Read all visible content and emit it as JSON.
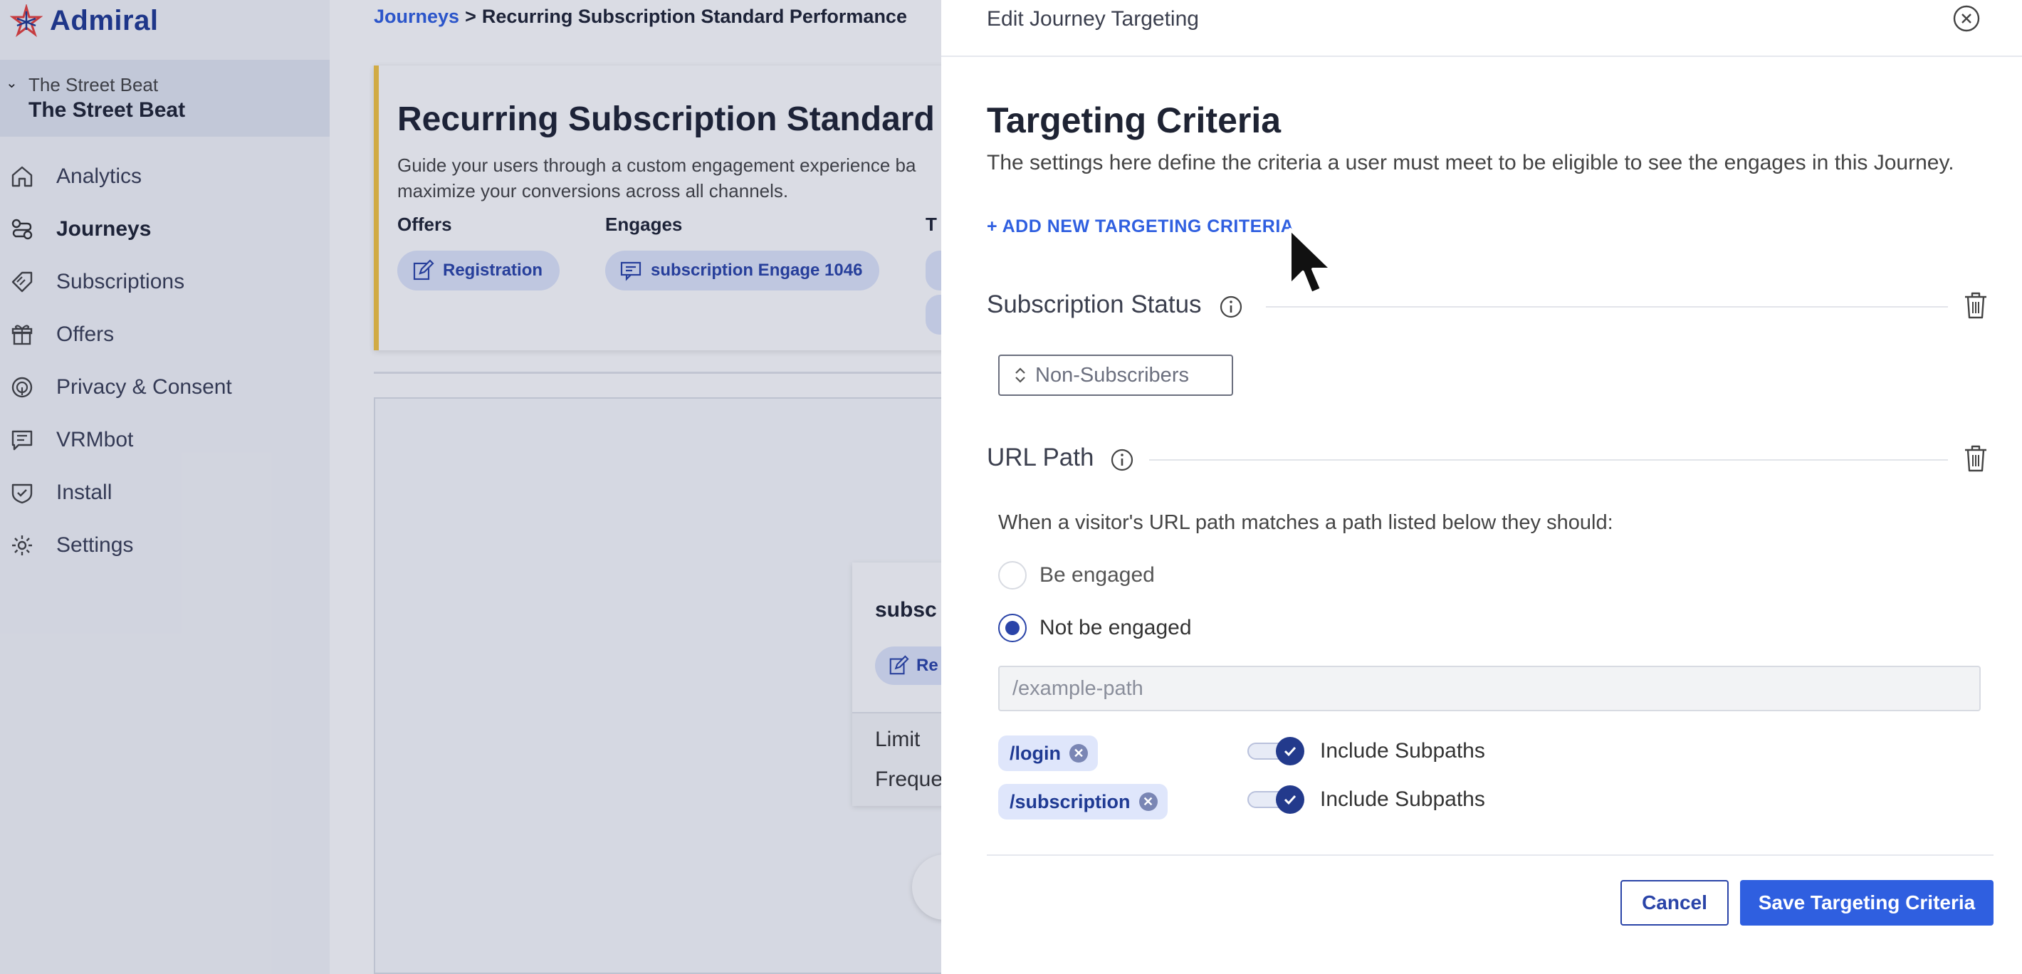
{
  "app": {
    "logo_text": "Admiral",
    "logo_icon": "admiral-star-icon"
  },
  "sidebar": {
    "site_sub": "The Street Beat",
    "site_main": "The Street Beat",
    "items": [
      {
        "label": "Analytics",
        "icon": "home-icon"
      },
      {
        "label": "Journeys",
        "icon": "journeys-icon",
        "active": true
      },
      {
        "label": "Subscriptions",
        "icon": "tag-icon"
      },
      {
        "label": "Offers",
        "icon": "gift-icon"
      },
      {
        "label": "Privacy & Consent",
        "icon": "privacy-icon"
      },
      {
        "label": "VRMbot",
        "icon": "chat-icon"
      },
      {
        "label": "Install",
        "icon": "shield-icon"
      },
      {
        "label": "Settings",
        "icon": "gear-icon"
      }
    ]
  },
  "main": {
    "breadcrumb": {
      "link": "Journeys",
      "separator": ">",
      "current": "Recurring Subscription Standard Performance"
    },
    "card": {
      "title": "Recurring Subscription Standard P",
      "desc_line1": "Guide your users through a custom engagement experience ba",
      "desc_line2": "maximize your conversions across all channels.",
      "col_offers": "Offers",
      "col_engages": "Engages",
      "col_third": "T",
      "offer_pill": "Registration",
      "engage_pill": "subscription Engage 1046"
    },
    "node": {
      "title": "subsc",
      "pill": "Re",
      "row1": "Limit",
      "row2": "Freque"
    }
  },
  "drawer": {
    "header_title": "Edit Journey Targeting",
    "section_title": "Targeting Criteria",
    "section_desc": "The settings here define the criteria a user must meet to be eligible to see the engages in this Journey.",
    "add_link": "+ ADD NEW TARGETING CRITERIA",
    "criteria": [
      {
        "label": "Subscription Status",
        "select_value": "Non-Subscribers"
      },
      {
        "label": "URL Path",
        "prompt": "When a visitor's URL path matches a path listed below they should:",
        "options": [
          {
            "label": "Be engaged",
            "selected": false
          },
          {
            "label": "Not be engaged",
            "selected": true
          }
        ],
        "input_placeholder": "/example-path",
        "paths": [
          {
            "path": "/login",
            "toggle_label": "Include Subpaths",
            "include_subpaths": true
          },
          {
            "path": "/subscription",
            "toggle_label": "Include Subpaths",
            "include_subpaths": true
          }
        ]
      }
    ],
    "cancel_label": "Cancel",
    "save_label": "Save Targeting Criteria"
  },
  "colors": {
    "primary": "#2f5fe0",
    "dark_primary": "#233a8c",
    "pill_bg": "#dfe6fb",
    "accent_yellow": "#f5c542"
  }
}
